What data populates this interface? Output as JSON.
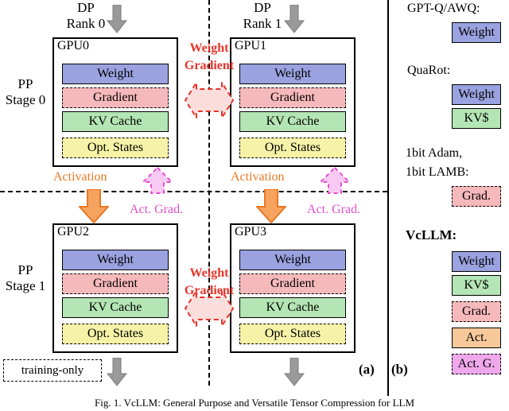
{
  "figure": {
    "caption": "Fig. 1. VcLLM: General Purpose and Versatile Tensor Compression for LLM",
    "panel_a_tag": "(a)",
    "panel_b_tag": "(b)"
  },
  "left_panel": {
    "dp_labels": [
      {
        "line1": "DP",
        "line2": "Rank 0"
      },
      {
        "line1": "DP",
        "line2": "Rank 1"
      }
    ],
    "pp_labels": [
      {
        "line1": "PP",
        "line2": "Stage 0"
      },
      {
        "line1": "PP",
        "line2": "Stage 1"
      }
    ],
    "gpus": [
      {
        "title": "GPU0",
        "bars": [
          {
            "label": "Weight",
            "color": "#9aa2e0",
            "style": "solid"
          },
          {
            "label": "Gradient",
            "color": "#f6b9bb",
            "style": "dashed"
          },
          {
            "label": "KV Cache",
            "color": "#b4e5b4",
            "style": "solid"
          },
          {
            "label": "Opt. States",
            "color": "#f6f3a8",
            "style": "dashed"
          }
        ]
      },
      {
        "title": "GPU1",
        "bars": [
          {
            "label": "Weight",
            "color": "#9aa2e0",
            "style": "solid"
          },
          {
            "label": "Gradient",
            "color": "#f6b9bb",
            "style": "dashed"
          },
          {
            "label": "KV Cache",
            "color": "#b4e5b4",
            "style": "solid"
          },
          {
            "label": "Opt. States",
            "color": "#f6f3a8",
            "style": "dashed"
          }
        ]
      },
      {
        "title": "GPU2",
        "bars": [
          {
            "label": "Weight",
            "color": "#9aa2e0",
            "style": "solid"
          },
          {
            "label": "Gradient",
            "color": "#f6b9bb",
            "style": "dashed"
          },
          {
            "label": "KV Cache",
            "color": "#b4e5b4",
            "style": "solid"
          },
          {
            "label": "Opt. States",
            "color": "#f6f3a8",
            "style": "dashed"
          }
        ]
      },
      {
        "title": "GPU3",
        "bars": [
          {
            "label": "Weight",
            "color": "#9aa2e0",
            "style": "solid"
          },
          {
            "label": "Gradient",
            "color": "#f6b9bb",
            "style": "dashed"
          },
          {
            "label": "KV Cache",
            "color": "#b4e5b4",
            "style": "solid"
          },
          {
            "label": "Opt. States",
            "color": "#f6f3a8",
            "style": "dashed"
          }
        ]
      }
    ],
    "annotations": {
      "weight_gradient_top": "Weight\nGradient",
      "weight_gradient_top_l1": "Weight",
      "weight_gradient_top_l2": "Gradient",
      "weight_gradient_bottom_l1": "Weight",
      "weight_gradient_bottom_l2": "Gradient",
      "activation_left": "Activation",
      "activation_right": "Activation",
      "act_grad_left": "Act. Grad.",
      "act_grad_right": "Act. Grad.",
      "training_only": "training-only"
    },
    "colors": {
      "red": "#e8332a",
      "orange": "#e87722",
      "pink": "#e44fd0",
      "grey_arrow": "#9a9a9a"
    }
  },
  "right_panel": {
    "groups": [
      {
        "title": "GPT-Q/AWQ:",
        "bars": [
          {
            "label": "Weight",
            "color": "#9aa2e0",
            "style": "solid"
          }
        ]
      },
      {
        "title": "QuaRot:",
        "bars": [
          {
            "label": "Weight",
            "color": "#9aa2e0",
            "style": "solid"
          },
          {
            "label": "KV$",
            "color": "#b4e5b4",
            "style": "solid"
          }
        ]
      },
      {
        "title_line1": "1bit Adam,",
        "title_line2": "1bit LAMB:",
        "bars": [
          {
            "label": "Grad.",
            "color": "#f6b9bb",
            "style": "dashed"
          }
        ]
      },
      {
        "title": "VcLLM:",
        "bars": [
          {
            "label": "Weight",
            "color": "#9aa2e0",
            "style": "solid"
          },
          {
            "label": "KV$",
            "color": "#b4e5b4",
            "style": "solid"
          },
          {
            "label": "Grad.",
            "color": "#f6b9bb",
            "style": "dashed"
          },
          {
            "label": "Act.",
            "color": "#f6c89a",
            "style": "solid"
          },
          {
            "label": "Act. G.",
            "color": "#f0a8ec",
            "style": "dashed"
          }
        ]
      }
    ]
  }
}
